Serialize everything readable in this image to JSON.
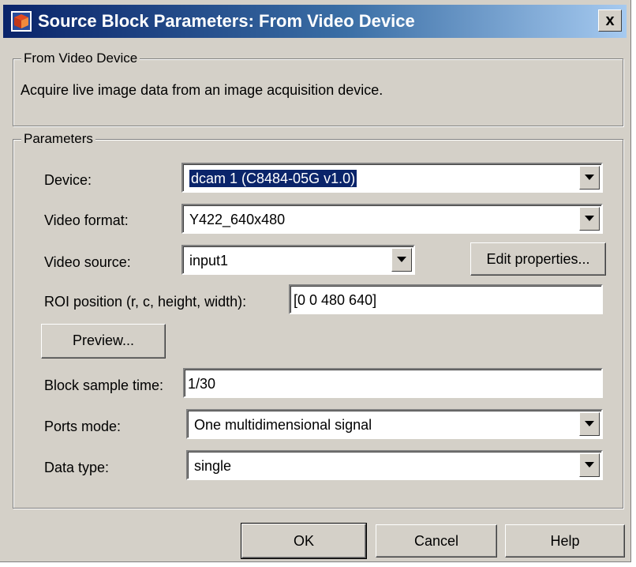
{
  "window": {
    "title": "Source Block Parameters: From Video Device",
    "close_label": "x"
  },
  "block_group": {
    "legend": "From Video Device",
    "description": "Acquire live image data from an image acquisition device."
  },
  "parameters": {
    "legend": "Parameters",
    "device": {
      "label": "Device:",
      "value": "dcam 1 (C8484-05G v1.0)"
    },
    "video_format": {
      "label": "Video format:",
      "value": "Y422_640x480"
    },
    "video_source": {
      "label": "Video source:",
      "value": "input1"
    },
    "edit_properties_label": "Edit properties...",
    "roi_position": {
      "label": "ROI position (r, c, height, width):",
      "value": "[0 0 480 640]"
    },
    "preview_label": "Preview...",
    "block_sample_time": {
      "label": "Block sample time:",
      "value": "1/30"
    },
    "ports_mode": {
      "label": "Ports mode:",
      "value": "One multidimensional signal"
    },
    "data_type": {
      "label": "Data type:",
      "value": "single"
    }
  },
  "buttons": {
    "ok": "OK",
    "cancel": "Cancel",
    "help": "Help"
  }
}
